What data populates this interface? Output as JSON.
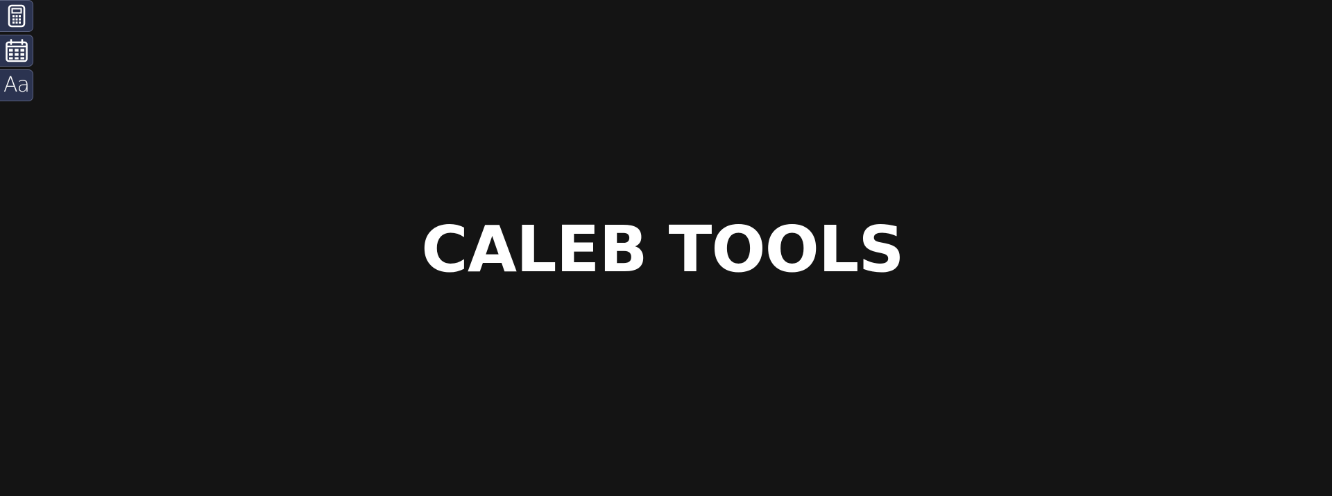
{
  "page": {
    "background_color": "#141414",
    "title": "CALEB TOOLS",
    "title_color": "#ffffff"
  },
  "toolbar": {
    "button_color": "#2b3350",
    "items": [
      {
        "name": "calculator",
        "icon": "calculator-icon"
      },
      {
        "name": "calendar",
        "icon": "calendar-icon"
      },
      {
        "name": "text",
        "icon": "text-format-icon",
        "glyph": "Aa"
      }
    ]
  }
}
